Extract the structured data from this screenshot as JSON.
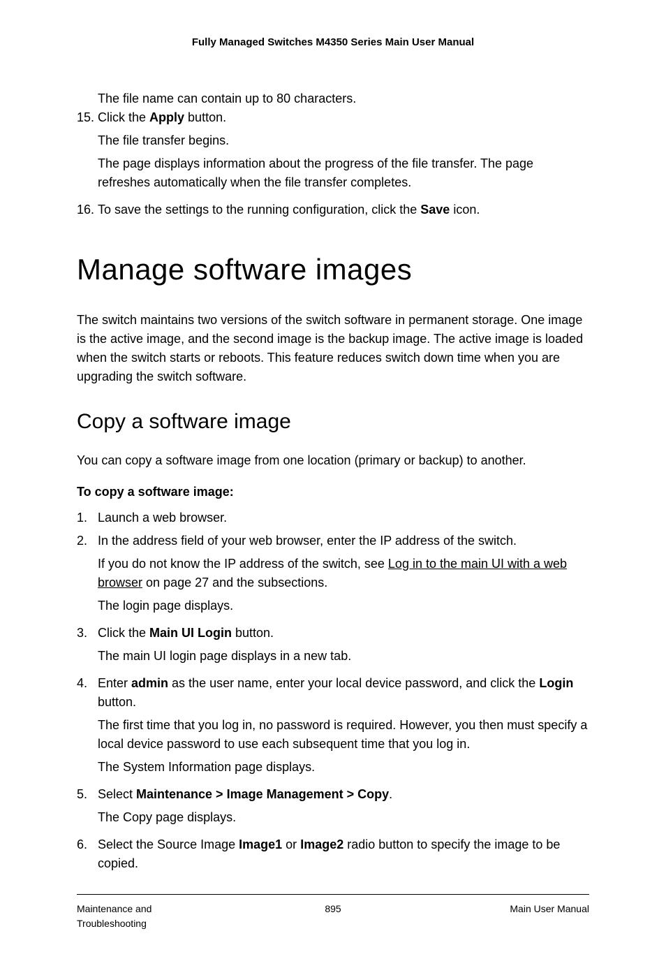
{
  "header": "Fully Managed Switches M4350 Series Main User Manual",
  "top_block": {
    "line1": "The file name can contain up to 80 characters.",
    "step15_num": "15.",
    "step15_a": "Click the ",
    "step15_b": "Apply",
    "step15_c": " button.",
    "step15_sub1": "The file transfer begins.",
    "step15_sub2": "The page displays information about the progress of the file transfer. The page refreshes automatically when the file transfer completes.",
    "step16_num": "16.",
    "step16_a": "To save the settings to the running configuration, click the ",
    "step16_b": "Save",
    "step16_c": " icon."
  },
  "h1": "Manage software images",
  "intro": "The switch maintains two versions of the switch software in permanent storage. One image is the active image, and the second image is the backup image. The active image is loaded when the switch starts or reboots. This feature reduces switch down time when you are upgrading the switch software.",
  "h2": "Copy a software image",
  "intro2": "You can copy a software image from one location (primary or backup) to another.",
  "lead": "To copy a software image:",
  "s1_num": "1.",
  "s1": "Launch a web browser.",
  "s2_num": "2.",
  "s2": "In the address field of your web browser, enter the IP address of the switch.",
  "s2_sub_a": "If you do not know the IP address of the switch, see ",
  "s2_sub_link": "Log in to the main UI with a web browser",
  "s2_sub_b": " on page 27 and the subsections.",
  "s2_sub2": "The login page displays.",
  "s3_num": "3.",
  "s3_a": "Click the ",
  "s3_b": "Main UI Login",
  "s3_c": " button.",
  "s3_sub": "The main UI login page displays in a new tab.",
  "s4_num": "4.",
  "s4_a": "Enter ",
  "s4_b": "admin",
  "s4_c": " as the user name, enter your local device password, and click the ",
  "s4_d": "Login",
  "s4_e": " button.",
  "s4_sub1": "The first time that you log in, no password is required. However, you then must specify a local device password to use each subsequent time that you log in.",
  "s4_sub2": "The System Information page displays.",
  "s5_num": "5.",
  "s5_a": "Select ",
  "s5_b": "Maintenance > Image Management > Copy",
  "s5_c": ".",
  "s5_sub": "The Copy page displays.",
  "s6_num": "6.",
  "s6_a": "Select the Source Image ",
  "s6_b": "Image1",
  "s6_c": " or ",
  "s6_d": "Image2",
  "s6_e": " radio button to specify the image to be copied.",
  "footer": {
    "left": "Maintenance and Troubleshooting",
    "center": "895",
    "right": "Main User Manual"
  }
}
